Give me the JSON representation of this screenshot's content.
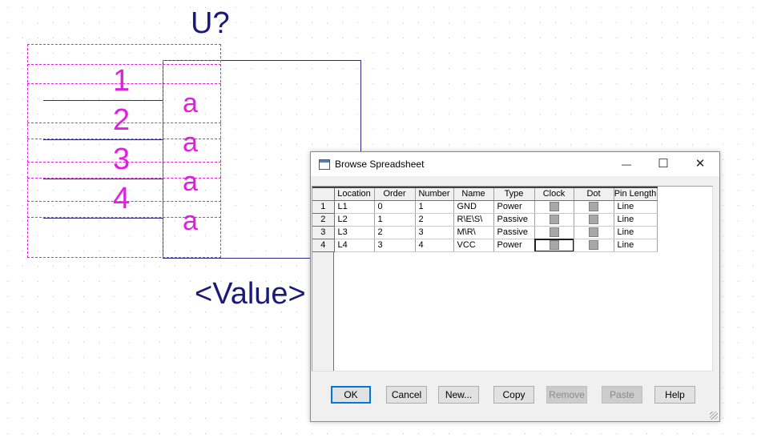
{
  "symbol": {
    "reference": "U?",
    "value": "<Value>",
    "pins": [
      {
        "number": "1",
        "name": "a"
      },
      {
        "number": "2",
        "name": "a"
      },
      {
        "number": "3",
        "name": "a"
      },
      {
        "number": "4",
        "name": "a"
      }
    ]
  },
  "dialog": {
    "title": "Browse Spreadsheet",
    "minimize_glyph": "—",
    "maximize_glyph": "☐",
    "close_glyph": "✕",
    "columns": [
      "Location",
      "Order",
      "Number",
      "Name",
      "Type",
      "Clock",
      "Dot",
      "Pin Length"
    ],
    "rows": [
      {
        "index": "1",
        "location": "L1",
        "order": "0",
        "number": "1",
        "name": "GND",
        "type": "Power",
        "length": "Line"
      },
      {
        "index": "2",
        "location": "L2",
        "order": "1",
        "number": "2",
        "name": "R\\E\\S\\",
        "type": "Passive",
        "length": "Line"
      },
      {
        "index": "3",
        "location": "L3",
        "order": "2",
        "number": "3",
        "name": "M\\R\\",
        "type": "Passive",
        "length": "Line"
      },
      {
        "index": "4",
        "location": "L4",
        "order": "3",
        "number": "4",
        "name": "VCC",
        "type": "Power",
        "length": "Line"
      }
    ],
    "buttons": {
      "ok": "OK",
      "cancel": "Cancel",
      "new": "New...",
      "copy": "Copy",
      "remove": "Remove",
      "paste": "Paste",
      "help": "Help"
    }
  }
}
